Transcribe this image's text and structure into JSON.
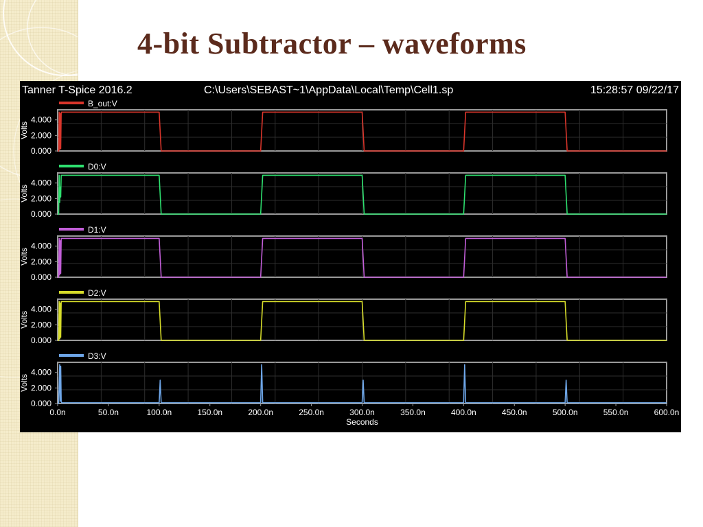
{
  "slide": {
    "title": "4-bit Subtractor – waveforms"
  },
  "window": {
    "app_title": "Tanner T-Spice 2016.2",
    "file_path": "C:\\Users\\SEBAST~1\\AppData\\Local\\Temp\\Cell1.sp",
    "timestamp": "15:28:57 09/22/17"
  },
  "chart_data": {
    "type": "line",
    "xlabel": "Seconds",
    "xlim": [
      0,
      600
    ],
    "x_ticks": [
      0,
      50,
      100,
      150,
      200,
      250,
      300,
      350,
      400,
      450,
      500,
      550,
      600
    ],
    "x_tick_labels": [
      "0.0n",
      "50.0n",
      "100.0n",
      "150.0n",
      "200.0n",
      "250.0n",
      "300.0n",
      "350.0n",
      "400.0n",
      "450.0n",
      "500.0n",
      "550.0n",
      "600.0n"
    ],
    "ylabel": "Volts",
    "ylim": [
      0,
      5.3
    ],
    "y_ticks": [
      0,
      2,
      4
    ],
    "y_tick_labels": [
      "0.000",
      "2.000",
      "4.000"
    ],
    "grid": true,
    "series": [
      {
        "name": "B_out:V",
        "color": "#d9352b",
        "x": [
          0,
          1,
          1.5,
          2,
          2.5,
          3,
          3.5,
          4,
          100,
          101,
          102,
          200,
          201,
          202,
          300,
          301,
          302,
          400,
          401,
          402,
          500,
          501,
          502,
          600
        ],
        "y": [
          0,
          0,
          5,
          0.2,
          4.8,
          0.3,
          5,
          5,
          5,
          2.5,
          0,
          0,
          2.5,
          5,
          5,
          2.5,
          0,
          0,
          2.5,
          5,
          5,
          2.5,
          0,
          0
        ]
      },
      {
        "name": "D0:V",
        "color": "#2ee06f",
        "x": [
          0,
          1,
          1.5,
          2,
          2.5,
          3,
          3.5,
          4,
          100,
          101,
          102,
          200,
          201,
          202,
          300,
          301,
          302,
          400,
          401,
          402,
          500,
          501,
          502,
          600
        ],
        "y": [
          0,
          0,
          5,
          1.5,
          3.5,
          2.2,
          5,
          5,
          5,
          2.5,
          0,
          0,
          2.5,
          5,
          5,
          2.5,
          0,
          0,
          2.5,
          5,
          5,
          2.5,
          0,
          0
        ]
      },
      {
        "name": "D1:V",
        "color": "#c25ed8",
        "x": [
          0,
          1,
          1.5,
          2,
          2.5,
          3,
          3.5,
          4,
          100,
          101,
          102,
          200,
          201,
          202,
          300,
          301,
          302,
          400,
          401,
          402,
          500,
          501,
          502,
          600
        ],
        "y": [
          0,
          0,
          5,
          0.3,
          4.7,
          0.5,
          5,
          5,
          5,
          2.5,
          0,
          0,
          2.5,
          5,
          5,
          2.5,
          0,
          0,
          2.5,
          5,
          5,
          2.5,
          0,
          0
        ]
      },
      {
        "name": "D2:V",
        "color": "#d6dc2a",
        "x": [
          0,
          1,
          1.5,
          2,
          2.5,
          3,
          3.5,
          4,
          100,
          101,
          102,
          200,
          201,
          202,
          300,
          301,
          302,
          400,
          401,
          402,
          500,
          501,
          502,
          600
        ],
        "y": [
          0,
          0,
          5,
          0.2,
          4.8,
          0.4,
          5,
          5,
          5,
          2.5,
          0,
          0,
          2.5,
          5,
          5,
          2.5,
          0,
          0,
          2.5,
          5,
          5,
          2.5,
          0,
          0
        ]
      },
      {
        "name": "D3:V",
        "color": "#6ea6e8",
        "x": [
          0,
          1,
          2,
          2.5,
          3,
          3.5,
          4,
          5,
          100,
          100.5,
          101,
          101.5,
          102,
          200,
          200.5,
          201,
          201.5,
          202,
          300,
          300.5,
          301,
          301.5,
          302,
          400,
          400.5,
          401,
          401.5,
          402,
          500,
          500.5,
          501,
          501.5,
          502,
          600
        ],
        "y": [
          0,
          0,
          5,
          0.3,
          4.8,
          0.2,
          0.1,
          0.1,
          0.1,
          1.5,
          3,
          1.5,
          0.1,
          0.1,
          2.5,
          5,
          2.5,
          0.1,
          0.1,
          1.5,
          3,
          1.5,
          0.1,
          0.1,
          2.5,
          5,
          2.5,
          0.1,
          0.1,
          1.5,
          3,
          1.5,
          0.1,
          0.1
        ]
      }
    ]
  }
}
